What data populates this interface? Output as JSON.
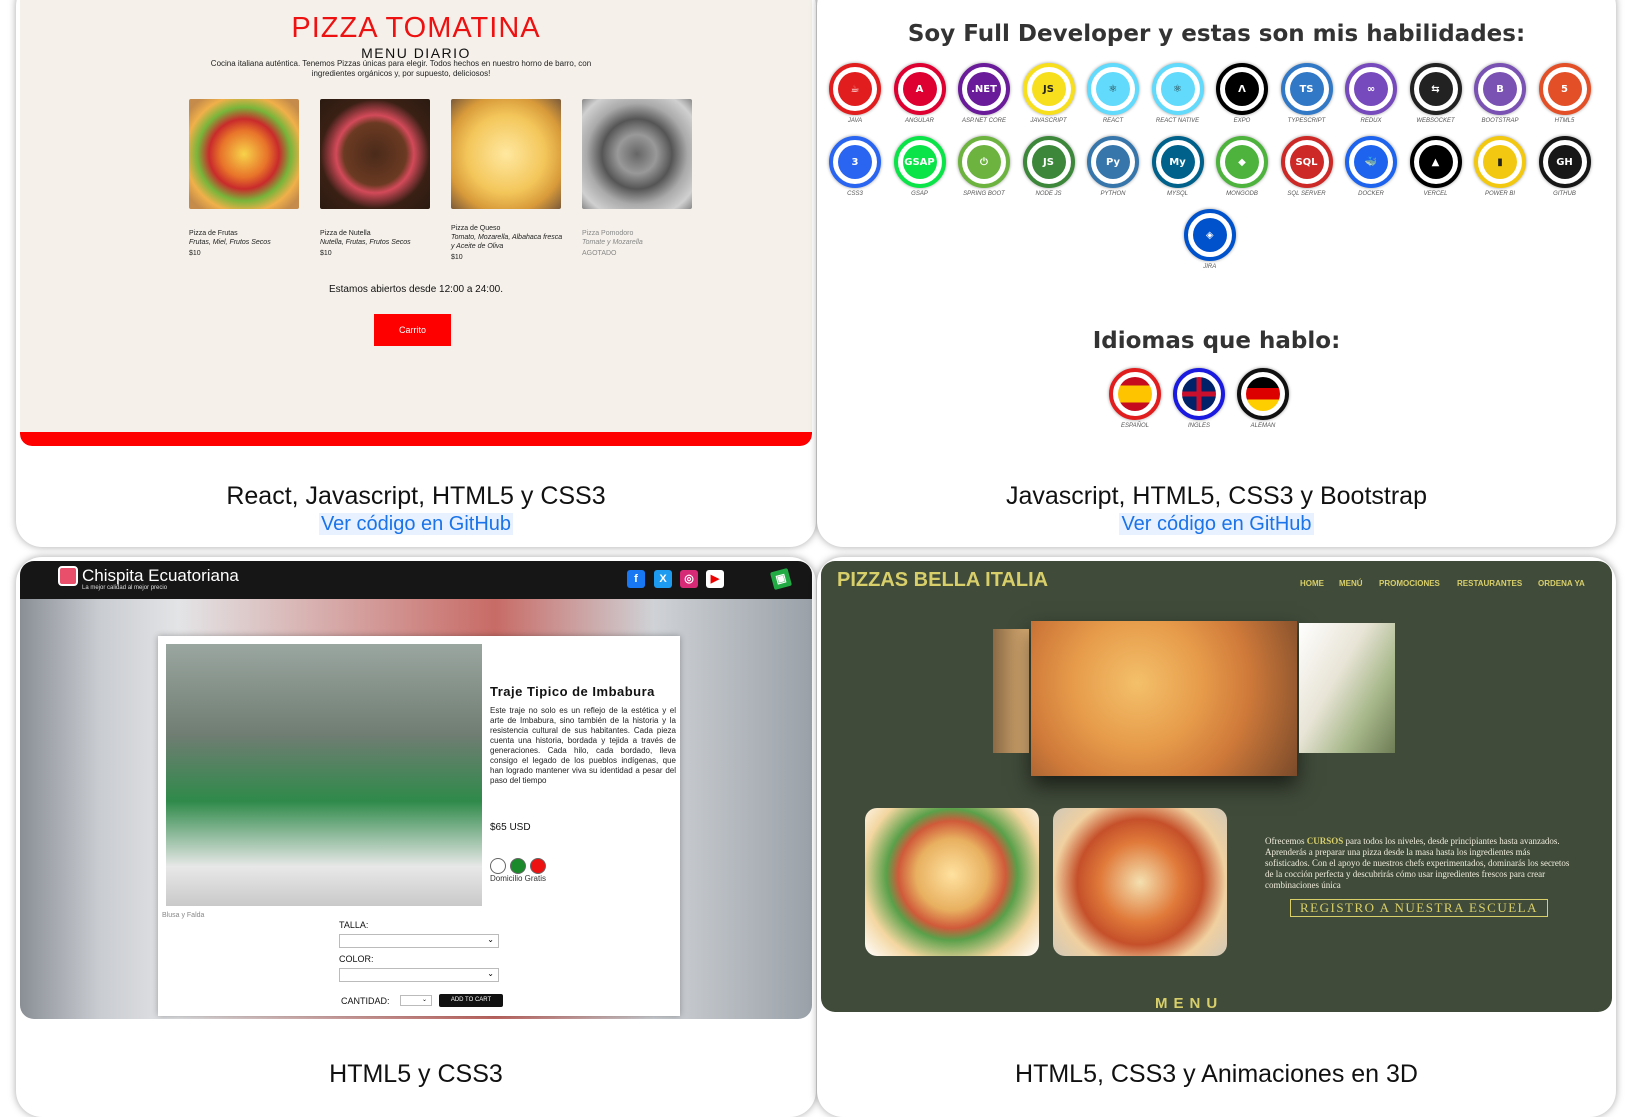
{
  "projects": [
    {
      "caption": "React, Javascript, HTML5 y CSS3",
      "link": "Ver código en GitHub",
      "preview": {
        "title": "PIZZA TOMATINA",
        "subtitle": "MENU DIARIO",
        "description": "Cocina italiana auténtica. Tenemos Pizzas únicas para elegir. Todos hechos en nuestro horno de barro, con ingredientes orgánicos y, por supuesto, deliciosos!",
        "items": [
          {
            "name": "Pizza de Frutas",
            "ingredients": "Frutas, Miel, Frutos Secos",
            "price": "$10"
          },
          {
            "name": "Pizza de Nutella",
            "ingredients": "Nutella, Frutas, Frutos Secos",
            "price": "$10"
          },
          {
            "name": "Pizza de Queso",
            "ingredients": "Tomato, Mozarella, Albahaca fresca y Aceite de Oliva",
            "price": "$10"
          },
          {
            "name": "Pizza Pomodoro",
            "ingredients": "Tomate y Mozarella",
            "price": "AGOTADO"
          }
        ],
        "open_hours": "Estamos abiertos desde 12:00 a 24:00.",
        "cart_label": "Carrito",
        "accent": "#ff0000"
      }
    },
    {
      "caption": "Javascript, HTML5, CSS3 y Bootstrap",
      "link": "Ver código en GitHub",
      "preview": {
        "heading": "Soy Full Developer y estas son mis habilidades:",
        "skills": [
          {
            "label": "JAVA",
            "color": "#e11d1d",
            "glyph": "☕"
          },
          {
            "label": "ANGULAR",
            "color": "#dd0031",
            "glyph": "A"
          },
          {
            "label": "ASP.NET CORE",
            "color": "#6a1b9a",
            "glyph": ".NET"
          },
          {
            "label": "JAVASCRIPT",
            "color": "#f7df1e",
            "glyph": "JS"
          },
          {
            "label": "REACT",
            "color": "#61dafb",
            "glyph": "⚛"
          },
          {
            "label": "REACT NATIVE",
            "color": "#61dafb",
            "glyph": "⚛"
          },
          {
            "label": "EXPO",
            "color": "#000000",
            "glyph": "Λ"
          },
          {
            "label": "TYPESCRIPT",
            "color": "#3178c6",
            "glyph": "TS"
          },
          {
            "label": "REDUX",
            "color": "#764abc",
            "glyph": "∞"
          },
          {
            "label": "WEBSOCKET",
            "color": "#222222",
            "glyph": "⇆"
          },
          {
            "label": "BOOTSTRAP",
            "color": "#7952b3",
            "glyph": "B"
          },
          {
            "label": "HTML5",
            "color": "#e34f26",
            "glyph": "5"
          },
          {
            "label": "CSS3",
            "color": "#2965f1",
            "glyph": "3"
          },
          {
            "label": "GSAP",
            "color": "#0ae448",
            "glyph": "GSAP"
          },
          {
            "label": "SPRING BOOT",
            "color": "#6db33f",
            "glyph": "⏻"
          },
          {
            "label": "NODE JS",
            "color": "#3c873a",
            "glyph": "JS"
          },
          {
            "label": "PYTHON",
            "color": "#3776ab",
            "glyph": "Py"
          },
          {
            "label": "MYSQL",
            "color": "#00618a",
            "glyph": "My"
          },
          {
            "label": "MONGODB",
            "color": "#4db33d",
            "glyph": "◆"
          },
          {
            "label": "SQL SERVER",
            "color": "#cc2927",
            "glyph": "SQL"
          },
          {
            "label": "DOCKER",
            "color": "#1d63ed",
            "glyph": "🐳"
          },
          {
            "label": "VERCEL",
            "color": "#000000",
            "glyph": "▲"
          },
          {
            "label": "POWER BI",
            "color": "#f2c811",
            "glyph": "▮"
          },
          {
            "label": "GITHUB",
            "color": "#181717",
            "glyph": "GH"
          },
          {
            "label": "JIRA",
            "color": "#0052cc",
            "glyph": "◈"
          }
        ],
        "languages_heading": "Idiomas que hablo:",
        "languages": [
          {
            "label": "ESPAÑOL",
            "color": "#c60b1e"
          },
          {
            "label": "INGLES",
            "color": "#012169"
          },
          {
            "label": "ALEMAN",
            "color": "#000000"
          }
        ]
      }
    },
    {
      "caption": "HTML5 y CSS3",
      "link": "",
      "preview": {
        "brand": "Chispita Ecuatoriana",
        "tagline": "La mejor calidad al mejor precio",
        "social": [
          "f",
          "X",
          "◎",
          "▶"
        ],
        "product_title": "Traje Tipico de Imbabura",
        "product_text": "Este traje no solo es un reflejo de la estética y el arte de Imbabura, sino también de la historia y la resistencia cultural de sus habitantes. Cada pieza cuenta una historia, bordada y tejida a través de generaciones. Cada hilo, cada bordado, lleva consigo el legado de los pueblos indígenas, que han logrado mantener viva su identidad a pesar del paso del tiempo",
        "price": "$65 USD",
        "shipping": "Domicilio Gratis",
        "image_alt": "Blusa y Falda",
        "size_label": "TALLA:",
        "color_label": "COLOR:",
        "qty_label": "CANTIDAD:",
        "add_label": "ADD TO CART",
        "colors": [
          "#ffffff",
          "#1a8a2a",
          "#ee1111"
        ]
      }
    },
    {
      "caption": "HTML5, CSS3 y Animaciones en 3D",
      "link": "",
      "preview": {
        "brand": "PIZZAS BELLA ITALIA",
        "nav": [
          "HOME",
          "MENÚ",
          "PROMOCIONES",
          "RESTAURANTES",
          "ORDENA YA"
        ],
        "text_before": "Ofrecemos ",
        "text_highlight": "CURSOS",
        "text_after": " para todos los niveles, desde principiantes hasta avanzados. Aprenderás a preparar una pizza desde la masa hasta los ingredientes más sofisticados. Con el apoyo de nuestros chefs experimentados, dominarás los secretos de la cocción perfecta y descubrirás cómo usar ingredientes frescos para crear combinaciones única",
        "register_label": "REGISTRO A NUESTRA ESCUELA",
        "menu_label": "MENU",
        "accent": "#d8cf6a"
      }
    }
  ]
}
